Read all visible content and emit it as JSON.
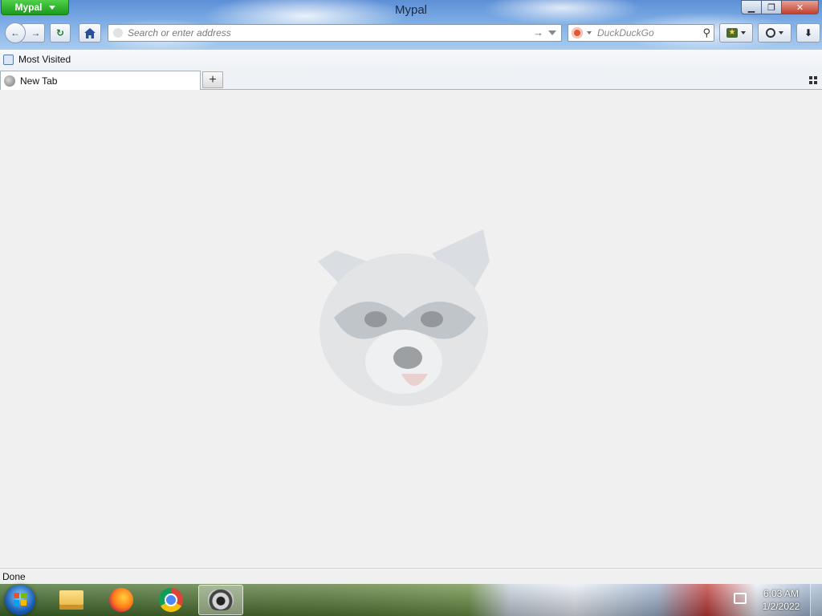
{
  "window": {
    "app_button_label": "Mypal",
    "title": "Mypal",
    "controls": {
      "minimize": "▁",
      "restore": "❐",
      "close": "✕"
    }
  },
  "toolbar": {
    "back_icon": "arrow-left-icon",
    "forward_icon": "arrow-right-icon",
    "reload_icon": "reload-icon",
    "home_icon": "home-icon",
    "url_placeholder": "Search or enter address",
    "search_engine": "DuckDuckGo",
    "search_placeholder": "DuckDuckGo",
    "bookmarks_icon": "bookmark-star-icon",
    "history_icon": "clock-icon",
    "downloads_icon": "download-arrow-icon"
  },
  "bookmarks_toolbar": {
    "items": [
      {
        "label": "Most Visited"
      }
    ]
  },
  "tabs": [
    {
      "label": "New Tab",
      "active": true
    }
  ],
  "content": {
    "logo": "mypal-raccoon-logo"
  },
  "status": {
    "text": "Done"
  },
  "taskbar": {
    "pinned": [
      "file-explorer-icon",
      "firefox-icon",
      "chrome-icon",
      "mypal-icon"
    ],
    "active": "mypal-icon",
    "clock": {
      "time": "6:03 AM",
      "date": "1/2/2022"
    }
  },
  "colors": {
    "app_button": "#2aa82a",
    "close_button": "#c2402d",
    "content_bg": "#f0f0f0"
  }
}
